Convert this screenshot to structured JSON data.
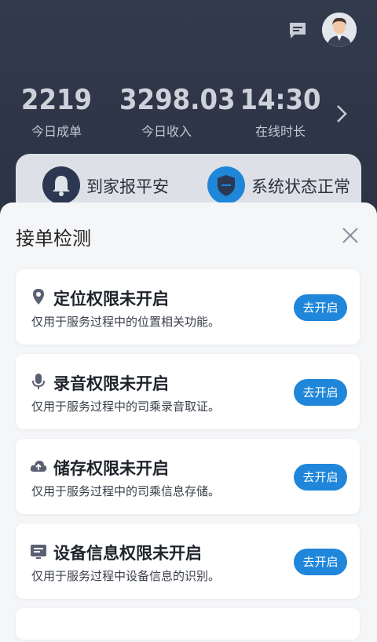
{
  "stats": [
    {
      "value": "2219",
      "label": "今日成单"
    },
    {
      "value": "3298.03",
      "label": "今日收入"
    },
    {
      "value": "14:30",
      "label": "在线时长"
    }
  ],
  "status": {
    "item1": "到家报平安",
    "item2": "系统状态正常"
  },
  "sheet": {
    "title": "接单检测"
  },
  "checks": [
    {
      "title": "定位权限未开启",
      "desc": "仅用于服务过程中的位置相关功能。",
      "button": "去开启",
      "icon": "location-pin-icon"
    },
    {
      "title": "录音权限未开启",
      "desc": "仅用于服务过程中的司乘录音取证。",
      "button": "去开启",
      "icon": "microphone-icon"
    },
    {
      "title": "储存权限未开启",
      "desc": "仅用于服务过程中的司乘信息存储。",
      "button": "去开启",
      "icon": "cloud-upload-icon"
    },
    {
      "title": "设备信息权限未开启",
      "desc": "仅用于服务过程中设备信息的识别。",
      "button": "去开启",
      "icon": "device-info-icon"
    }
  ],
  "colors": {
    "accent": "#1f86d9",
    "header_bg": "#2f3749",
    "sheet_bg": "#f5f6f8"
  }
}
